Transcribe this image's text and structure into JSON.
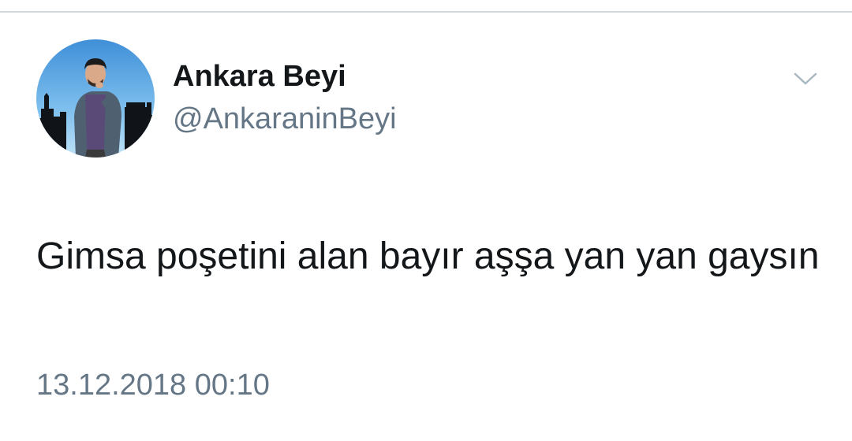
{
  "tweet": {
    "author": {
      "display_name": "Ankara Beyi",
      "username": "@AnkaraninBeyi",
      "avatar_icon": "profile-avatar-illustration"
    },
    "text": "Gimsa poşetini alan bayır aşşa yan yan gaysın",
    "timestamp": "13.12.2018 00:10",
    "more_icon": "chevron-down-icon"
  },
  "colors": {
    "text_primary": "#14171a",
    "text_secondary": "#657786",
    "divider": "#d3d7db",
    "chevron": "#aab8c2",
    "avatar_sky": "#5aa3e0"
  }
}
